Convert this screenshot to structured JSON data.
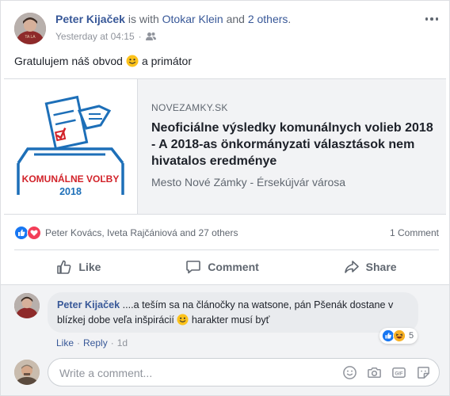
{
  "post": {
    "author": "Peter Kijaček",
    "with_text": " is with ",
    "tagged": "Otokar Klein",
    "and_text": " and ",
    "others": "2 others",
    "period": ".",
    "timestamp": "Yesterday at 04:15",
    "audience_icon": "friends-icon",
    "text_before": "Gratulujem náš obvod",
    "emoji": "slightly-smiling-face",
    "text_after": "a primátor"
  },
  "link_preview": {
    "domain": "NOVEZAMKY.SK",
    "title": "Neoficiálne výsledky komunálnych volieb 2018 - A 2018-as önkormányzati választások nem hivatalos eredménye",
    "source": "Mesto Nové Zámky - Érsekújvár városa",
    "image_caption_line1": "KOMUNÁLNE VOĽBY",
    "image_caption_line2": "2018"
  },
  "reactions": {
    "types": [
      "like",
      "love"
    ],
    "summary": "Peter Kovács, Iveta Rajčániová and 27 others",
    "comments_count": "1 Comment"
  },
  "actions": {
    "like": "Like",
    "comment": "Comment",
    "share": "Share"
  },
  "comment": {
    "author": "Peter Kijaček",
    "text_before": "....a teším sa na článočky na watsone, pán Pšenák dostane v blízkej dobe veľa inšpirácií",
    "emoji": "slightly-smiling-face",
    "text_after": "harakter musí byť",
    "reactions": [
      "like",
      "haha"
    ],
    "reaction_count": "5",
    "like_label": "Like",
    "reply_label": "Reply",
    "separator": "·",
    "age": "1d"
  },
  "composer": {
    "placeholder": "Write a comment...",
    "icons": [
      "emoji-icon",
      "camera-icon",
      "gif-icon",
      "sticker-icon"
    ]
  },
  "colors": {
    "link": "#385898",
    "muted": "#606770",
    "like_blue": "#1877f2",
    "love_red": "#f33e58",
    "haha_yellow": "#f7b125",
    "ballot_blue": "#1d6fb8",
    "ballot_red": "#d2232a"
  }
}
